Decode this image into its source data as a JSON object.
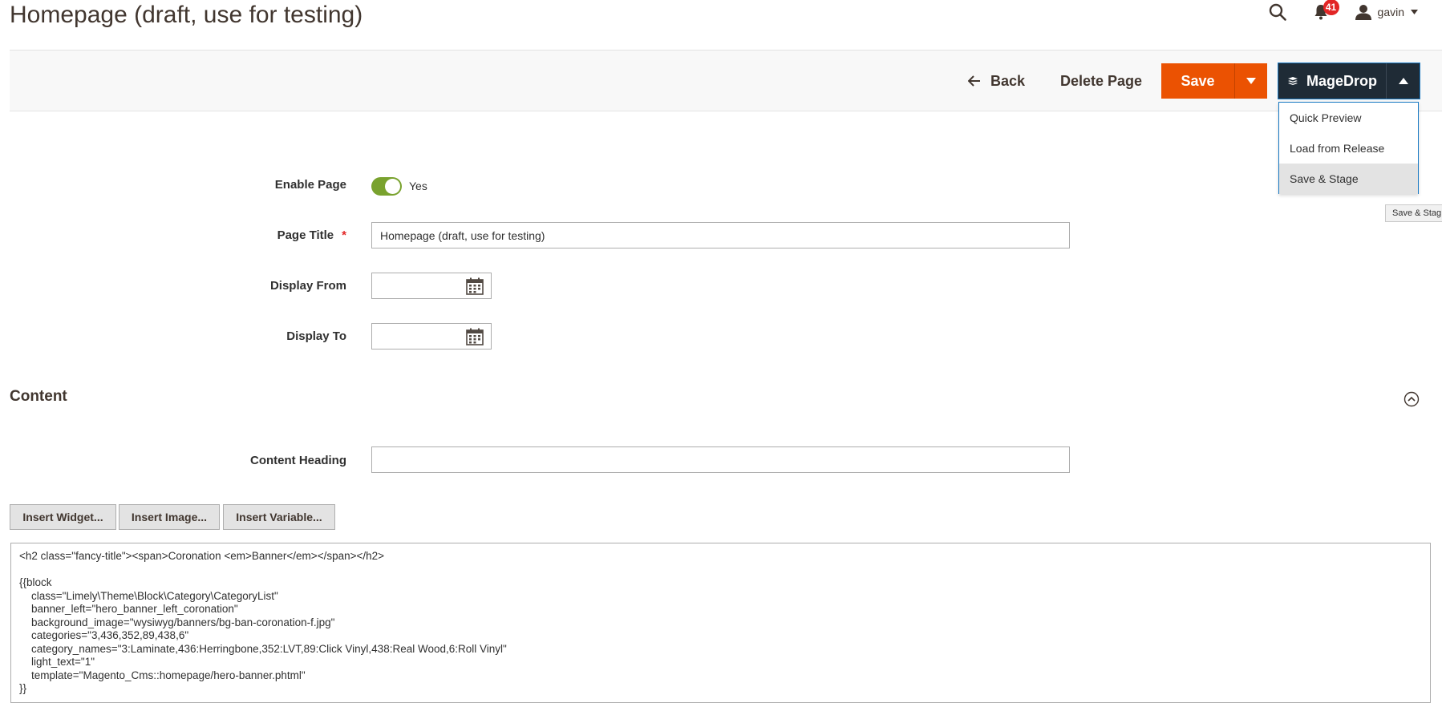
{
  "header": {
    "page_title": "Homepage (draft, use for testing)",
    "notification_count": "41",
    "user_name": "gavin"
  },
  "actions": {
    "back_label": "Back",
    "delete_label": "Delete Page",
    "save_label": "Save",
    "magedrop_label": "MageDrop",
    "magedrop_menu": [
      {
        "label": "Quick Preview"
      },
      {
        "label": "Load from Release"
      },
      {
        "label": "Save & Stage"
      }
    ],
    "tooltip_text": "Save & Stag"
  },
  "form": {
    "enable_page_label": "Enable Page",
    "enable_page_value": "Yes",
    "page_title_label": "Page Title",
    "page_title_value": "Homepage (draft, use for testing)",
    "display_from_label": "Display From",
    "display_from_value": "",
    "display_to_label": "Display To",
    "display_to_value": ""
  },
  "content": {
    "section_title": "Content",
    "heading_label": "Content Heading",
    "heading_value": "",
    "insert_widget": "Insert Widget...",
    "insert_image": "Insert Image...",
    "insert_variable": "Insert Variable...",
    "editor_value": "<h2 class=\"fancy-title\"><span>Coronation <em>Banner</em></span></h2>\n\n{{block\n    class=\"Limely\\Theme\\Block\\Category\\CategoryList\"\n    banner_left=\"hero_banner_left_coronation\"\n    background_image=\"wysiwyg/banners/bg-ban-coronation-f.jpg\"\n    categories=\"3,436,352,89,438,6\"\n    category_names=\"3:Laminate,436:Herringbone,352:LVT,89:Click Vinyl,438:Real Wood,6:Roll Vinyl\"\n    light_text=\"1\"\n    template=\"Magento_Cms::homepage/hero-banner.phtml\"\n}}"
  },
  "colors": {
    "accent_orange": "#eb5202",
    "magedrop_dark": "#1f2b36",
    "toggle_green": "#79a22e",
    "badge_red": "#e22626"
  }
}
